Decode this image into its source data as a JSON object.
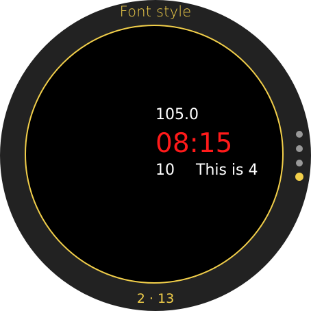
{
  "header": {
    "title": "Font style"
  },
  "content": {
    "top_value": "105.0",
    "time": "08:15",
    "bottom_left": "10",
    "bottom_right": "This is 4"
  },
  "footer": {
    "text": "2 · 13"
  },
  "page_indicator": {
    "total": 4,
    "active_index": 3
  },
  "colors": {
    "accent": "#f2cf4a",
    "time": "#ff1a1a",
    "background": "#000000",
    "bezel": "#222222",
    "dot_inactive": "#999999"
  }
}
